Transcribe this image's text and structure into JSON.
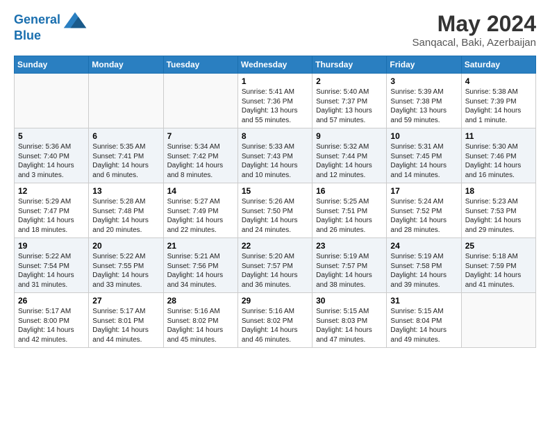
{
  "header": {
    "logo_line1": "General",
    "logo_line2": "Blue",
    "month_year": "May 2024",
    "location": "Sanqacal, Baki, Azerbaijan"
  },
  "days_of_week": [
    "Sunday",
    "Monday",
    "Tuesday",
    "Wednesday",
    "Thursday",
    "Friday",
    "Saturday"
  ],
  "weeks": [
    [
      {
        "day": "",
        "info": ""
      },
      {
        "day": "",
        "info": ""
      },
      {
        "day": "",
        "info": ""
      },
      {
        "day": "1",
        "info": "Sunrise: 5:41 AM\nSunset: 7:36 PM\nDaylight: 13 hours\nand 55 minutes."
      },
      {
        "day": "2",
        "info": "Sunrise: 5:40 AM\nSunset: 7:37 PM\nDaylight: 13 hours\nand 57 minutes."
      },
      {
        "day": "3",
        "info": "Sunrise: 5:39 AM\nSunset: 7:38 PM\nDaylight: 13 hours\nand 59 minutes."
      },
      {
        "day": "4",
        "info": "Sunrise: 5:38 AM\nSunset: 7:39 PM\nDaylight: 14 hours\nand 1 minute."
      }
    ],
    [
      {
        "day": "5",
        "info": "Sunrise: 5:36 AM\nSunset: 7:40 PM\nDaylight: 14 hours\nand 3 minutes."
      },
      {
        "day": "6",
        "info": "Sunrise: 5:35 AM\nSunset: 7:41 PM\nDaylight: 14 hours\nand 6 minutes."
      },
      {
        "day": "7",
        "info": "Sunrise: 5:34 AM\nSunset: 7:42 PM\nDaylight: 14 hours\nand 8 minutes."
      },
      {
        "day": "8",
        "info": "Sunrise: 5:33 AM\nSunset: 7:43 PM\nDaylight: 14 hours\nand 10 minutes."
      },
      {
        "day": "9",
        "info": "Sunrise: 5:32 AM\nSunset: 7:44 PM\nDaylight: 14 hours\nand 12 minutes."
      },
      {
        "day": "10",
        "info": "Sunrise: 5:31 AM\nSunset: 7:45 PM\nDaylight: 14 hours\nand 14 minutes."
      },
      {
        "day": "11",
        "info": "Sunrise: 5:30 AM\nSunset: 7:46 PM\nDaylight: 14 hours\nand 16 minutes."
      }
    ],
    [
      {
        "day": "12",
        "info": "Sunrise: 5:29 AM\nSunset: 7:47 PM\nDaylight: 14 hours\nand 18 minutes."
      },
      {
        "day": "13",
        "info": "Sunrise: 5:28 AM\nSunset: 7:48 PM\nDaylight: 14 hours\nand 20 minutes."
      },
      {
        "day": "14",
        "info": "Sunrise: 5:27 AM\nSunset: 7:49 PM\nDaylight: 14 hours\nand 22 minutes."
      },
      {
        "day": "15",
        "info": "Sunrise: 5:26 AM\nSunset: 7:50 PM\nDaylight: 14 hours\nand 24 minutes."
      },
      {
        "day": "16",
        "info": "Sunrise: 5:25 AM\nSunset: 7:51 PM\nDaylight: 14 hours\nand 26 minutes."
      },
      {
        "day": "17",
        "info": "Sunrise: 5:24 AM\nSunset: 7:52 PM\nDaylight: 14 hours\nand 28 minutes."
      },
      {
        "day": "18",
        "info": "Sunrise: 5:23 AM\nSunset: 7:53 PM\nDaylight: 14 hours\nand 29 minutes."
      }
    ],
    [
      {
        "day": "19",
        "info": "Sunrise: 5:22 AM\nSunset: 7:54 PM\nDaylight: 14 hours\nand 31 minutes."
      },
      {
        "day": "20",
        "info": "Sunrise: 5:22 AM\nSunset: 7:55 PM\nDaylight: 14 hours\nand 33 minutes."
      },
      {
        "day": "21",
        "info": "Sunrise: 5:21 AM\nSunset: 7:56 PM\nDaylight: 14 hours\nand 34 minutes."
      },
      {
        "day": "22",
        "info": "Sunrise: 5:20 AM\nSunset: 7:57 PM\nDaylight: 14 hours\nand 36 minutes."
      },
      {
        "day": "23",
        "info": "Sunrise: 5:19 AM\nSunset: 7:57 PM\nDaylight: 14 hours\nand 38 minutes."
      },
      {
        "day": "24",
        "info": "Sunrise: 5:19 AM\nSunset: 7:58 PM\nDaylight: 14 hours\nand 39 minutes."
      },
      {
        "day": "25",
        "info": "Sunrise: 5:18 AM\nSunset: 7:59 PM\nDaylight: 14 hours\nand 41 minutes."
      }
    ],
    [
      {
        "day": "26",
        "info": "Sunrise: 5:17 AM\nSunset: 8:00 PM\nDaylight: 14 hours\nand 42 minutes."
      },
      {
        "day": "27",
        "info": "Sunrise: 5:17 AM\nSunset: 8:01 PM\nDaylight: 14 hours\nand 44 minutes."
      },
      {
        "day": "28",
        "info": "Sunrise: 5:16 AM\nSunset: 8:02 PM\nDaylight: 14 hours\nand 45 minutes."
      },
      {
        "day": "29",
        "info": "Sunrise: 5:16 AM\nSunset: 8:02 PM\nDaylight: 14 hours\nand 46 minutes."
      },
      {
        "day": "30",
        "info": "Sunrise: 5:15 AM\nSunset: 8:03 PM\nDaylight: 14 hours\nand 47 minutes."
      },
      {
        "day": "31",
        "info": "Sunrise: 5:15 AM\nSunset: 8:04 PM\nDaylight: 14 hours\nand 49 minutes."
      },
      {
        "day": "",
        "info": ""
      }
    ]
  ]
}
